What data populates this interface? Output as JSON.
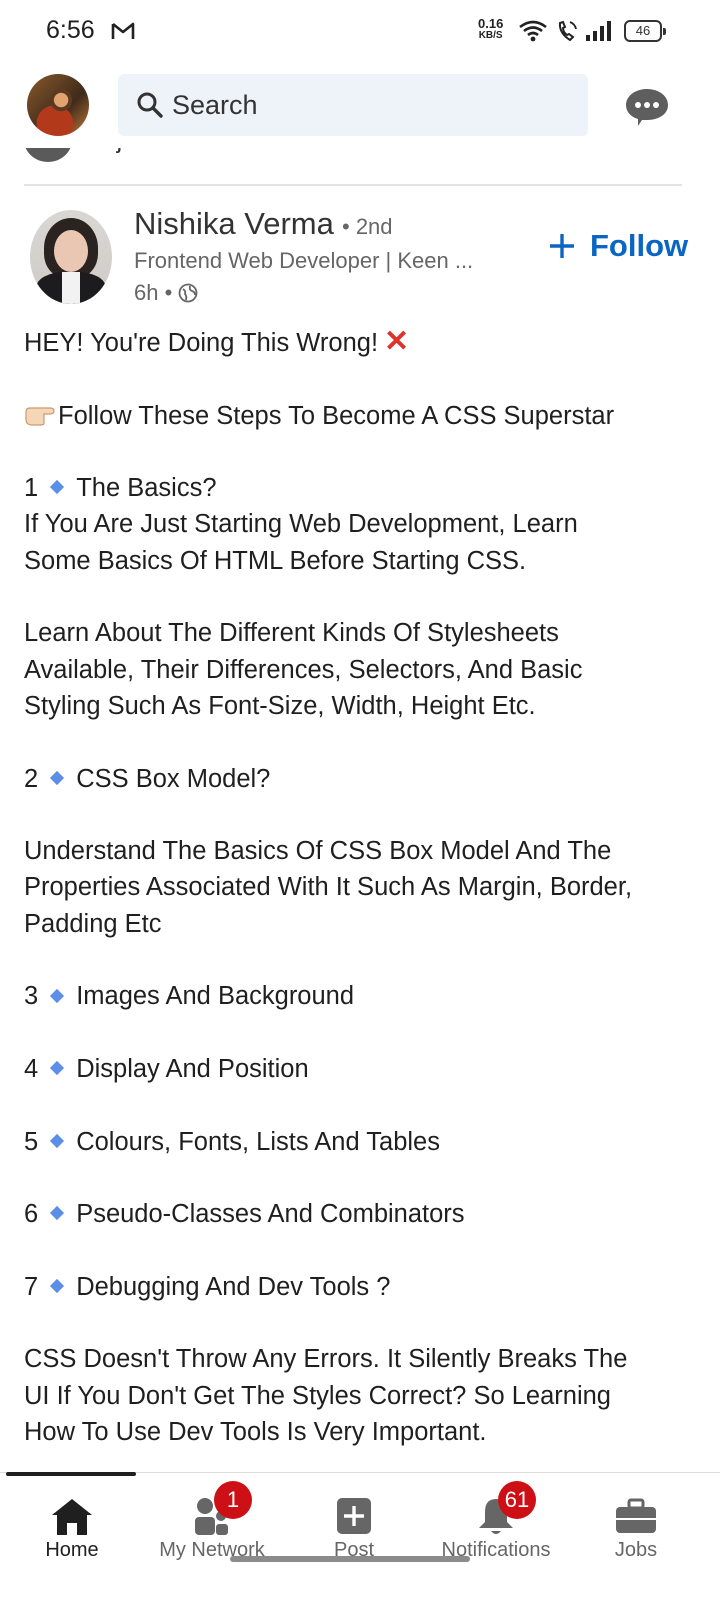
{
  "status_bar": {
    "time": "6:56",
    "speed_value": "0.16",
    "speed_unit": "KB/S",
    "battery": "46"
  },
  "top_bar": {
    "search_placeholder": "Search"
  },
  "peek": {
    "text": "Sajal Sharma Awasthi commented on this"
  },
  "post": {
    "author": {
      "name": "Nishika Verma",
      "degree": "• 2nd",
      "headline": "Frontend Web Developer | Keen ...",
      "time": "6h •"
    },
    "follow_label": "Follow",
    "lines": [
      "HEY! You're Doing This Wrong!",
      "",
      "Follow These Steps To Become A CSS Superstar",
      "",
      "1",
      "The Basics?",
      "If You Are Just Starting Web Development, Learn",
      "Some Basics Of HTML Before Starting CSS.",
      "",
      "Learn About The Different Kinds Of Stylesheets",
      "Available, Their Differences, Selectors, And Basic",
      "Styling Such As Font-Size, Width, Height Etc.",
      "",
      "2",
      "CSS Box Model?",
      "",
      "Understand The Basics Of CSS Box Model And The",
      "Properties Associated With It Such As Margin, Border,",
      "Padding Etc",
      "",
      "3",
      "Images And Background",
      "",
      "4",
      "Display And Position",
      "",
      "5",
      "Colours, Fonts, Lists And Tables",
      "",
      "6",
      "Pseudo-Classes And Combinators",
      "",
      "7",
      "Debugging And Dev Tools ?",
      "",
      "CSS Doesn't Throw Any Errors. It Silently Breaks The",
      "UI If You Don't Get The Styles Correct? So Learning",
      "How To Use Dev Tools Is Very Important."
    ]
  },
  "bottom_nav": {
    "items": [
      {
        "label": "Home",
        "icon": "home-icon"
      },
      {
        "label": "My Network",
        "icon": "network-icon",
        "badge": "1"
      },
      {
        "label": "Post",
        "icon": "post-icon"
      },
      {
        "label": "Notifications",
        "icon": "bell-icon",
        "badge": "61"
      },
      {
        "label": "Jobs",
        "icon": "briefcase-icon"
      }
    ]
  },
  "colors": {
    "accent": "#0a66c2",
    "badge": "#cc1016",
    "search_bg": "#edf3f8",
    "bullet": "#5b8ee6"
  }
}
